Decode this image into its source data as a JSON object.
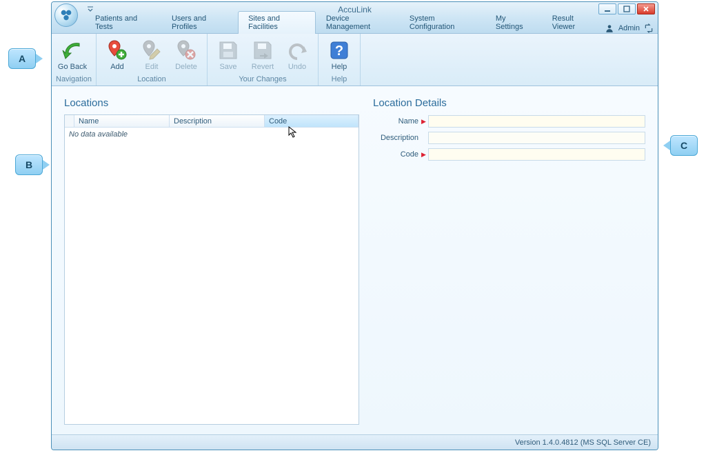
{
  "callouts": {
    "a": "A",
    "b": "B",
    "c": "C"
  },
  "window": {
    "title": "AccuLink"
  },
  "tabs": {
    "patients": "Patients and Tests",
    "users": "Users and Profiles",
    "sites": "Sites and Facilities",
    "device": "Device Management",
    "sysconfig": "System Configuration",
    "mysettings": "My Settings",
    "results": "Result Viewer"
  },
  "user": {
    "name": "Admin"
  },
  "ribbon": {
    "groups": {
      "navigation": {
        "caption": "Navigation",
        "goback": "Go Back"
      },
      "location": {
        "caption": "Location",
        "add": "Add",
        "edit": "Edit",
        "delete": "Delete"
      },
      "changes": {
        "caption": "Your Changes",
        "save": "Save",
        "revert": "Revert",
        "undo": "Undo"
      },
      "help": {
        "caption": "Help",
        "help": "Help"
      }
    }
  },
  "panels": {
    "locations": {
      "title": "Locations",
      "columns": {
        "name": "Name",
        "description": "Description",
        "code": "Code"
      },
      "empty": "No data available"
    },
    "details": {
      "title": "Location Details",
      "fields": {
        "name": "Name",
        "description": "Description",
        "code": "Code"
      }
    }
  },
  "status": {
    "version": "Version 1.4.0.4812 (MS SQL Server CE)"
  }
}
